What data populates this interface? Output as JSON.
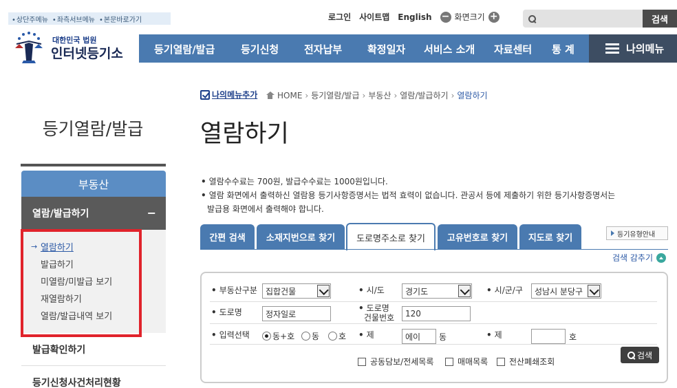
{
  "skip_links": [
    "상단주메뉴",
    "좌측서브메뉴",
    "본문바로가기"
  ],
  "util": {
    "login": "로그인",
    "sitemap": "사이트맵",
    "english": "English",
    "zoom_label": "화면크기"
  },
  "search": {
    "placeholder": "",
    "button": "검색"
  },
  "logo": {
    "small": "대한민국 법원",
    "big": "인터넷등기소"
  },
  "gnb": [
    "등기열람/발급",
    "등기신청",
    "전자납부",
    "확정일자",
    "서비스 소개",
    "자료센터",
    "통 계"
  ],
  "my_menu": "나의메뉴",
  "left": {
    "title": "등기열람/발급",
    "realty": "부동산",
    "view_issue": "열람/발급하기",
    "sub": [
      "열람하기",
      "발급하기",
      "미열람/미발급 보기",
      "재열람하기",
      "열람/발급내역 보기"
    ],
    "others": [
      "발급확인하기",
      "등기신청사건처리현황"
    ]
  },
  "breadcrumb": {
    "add_my": "나의메뉴추가",
    "items": [
      "HOME",
      "등기열람/발급",
      "부동산",
      "열람/발급하기",
      "열람하기"
    ]
  },
  "page_title": "열람하기",
  "notices": [
    "열람수수료는 700원, 발급수수료는 1000원입니다.",
    "열람 화면에서 출력하신 열람용 등기사항증명서는 법적 효력이 없습니다. 관공서 등에 제출하기 위한 등기사항증명서는",
    "발급용 화면에서 출력해야 합니다."
  ],
  "tabs": [
    "간편 검색",
    "소재지번으로 찾기",
    "도로명주소로 찾기",
    "고유번호로 찾기",
    "지도로 찾기"
  ],
  "active_tab": "도로명주소로 찾기",
  "guide_button": "등기유형안내",
  "hide_search": "검색 감추기",
  "form": {
    "realty_type_label": "부동산구분",
    "realty_type_value": "집합건물",
    "sido_label": "시/도",
    "sido_value": "경기도",
    "sigungu_label": "시/군/구",
    "sigungu_value": "성남시 분당구",
    "road_label": "도로명",
    "road_value": "정자일로",
    "bldg_no_label_1": "도로명",
    "bldg_no_label_2": "건물번호",
    "bldg_no_value": "120",
    "input_sel_label": "입력선택",
    "radios": [
      "동+호",
      "동",
      "호"
    ],
    "je1_label": "제",
    "dong_value": "에이",
    "dong_unit": "동",
    "je2_label": "제",
    "ho_value": "",
    "ho_unit": "호",
    "checks": [
      "공동담보/전세목록",
      "매매목록",
      "전산폐쇄조회"
    ],
    "search_button": "검색"
  },
  "colors": {
    "nav_blue": "#4a7ab0",
    "highlight_red": "#e0232b"
  }
}
